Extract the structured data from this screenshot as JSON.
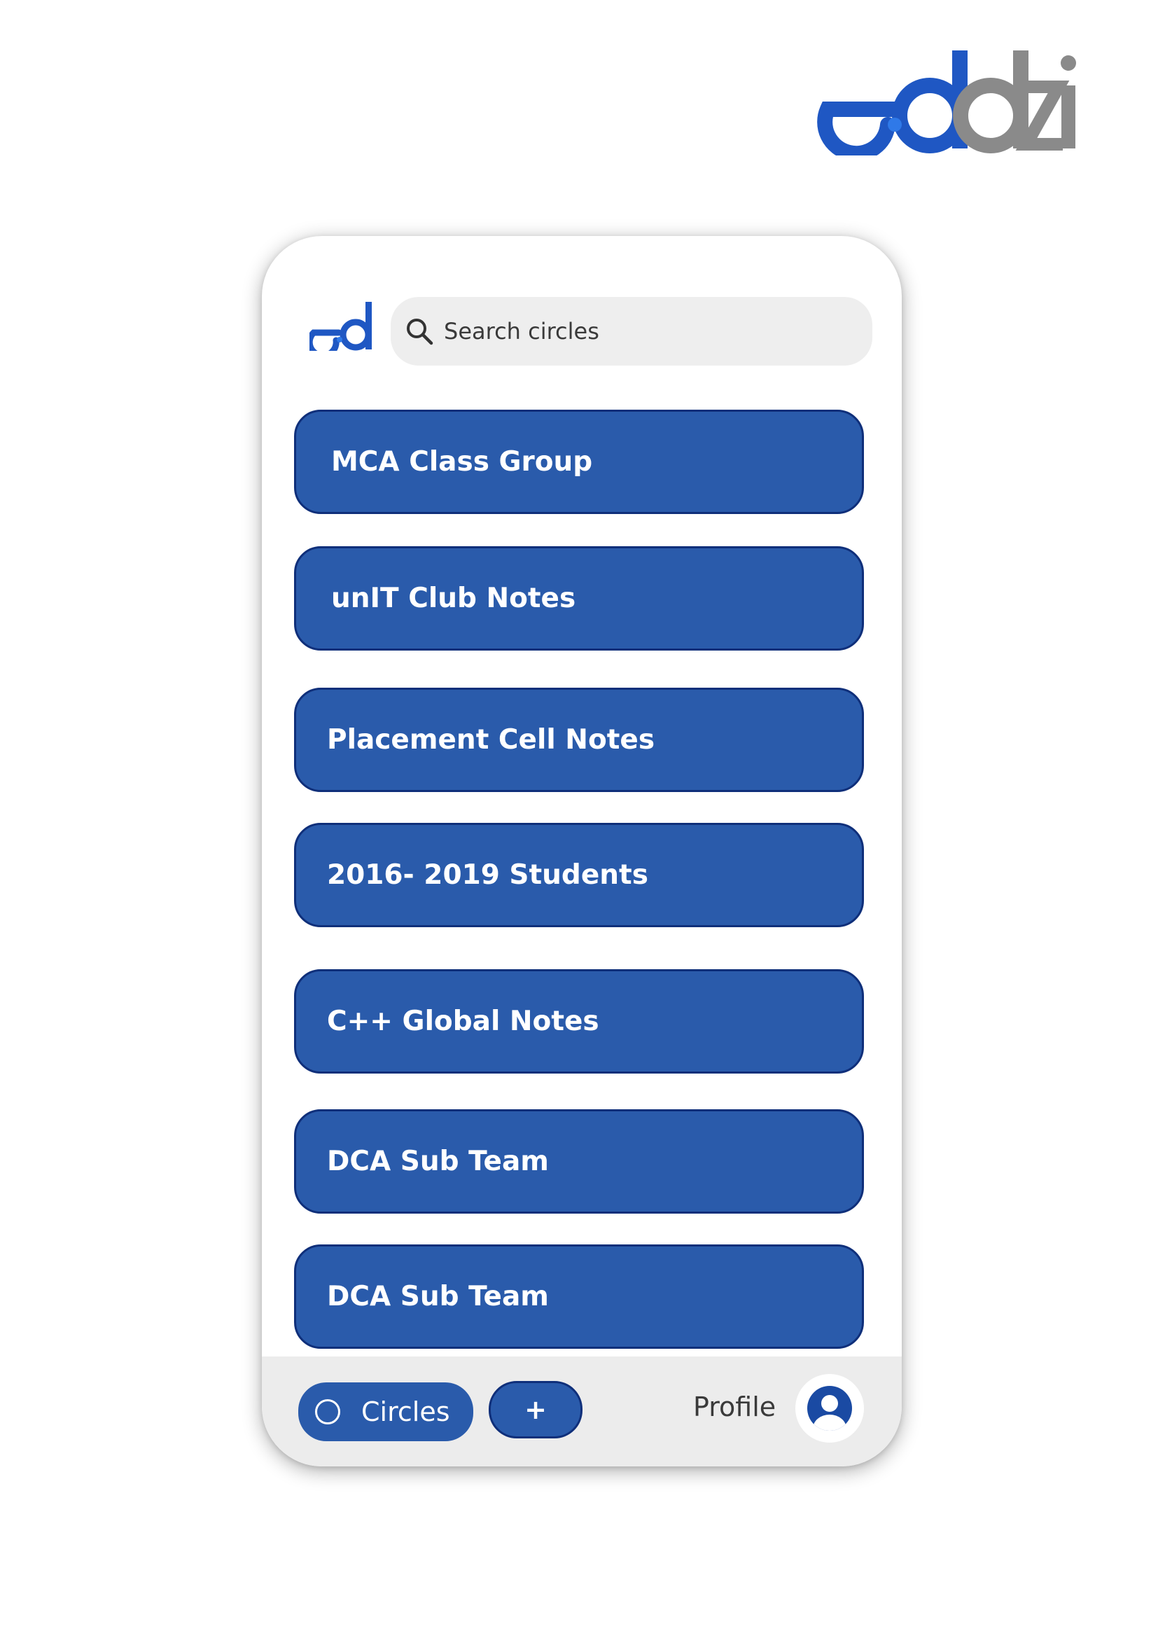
{
  "brand": {
    "logo_text": "eddzi",
    "primary_color": "#1f57c3",
    "secondary_color": "#8a8a8a"
  },
  "header": {
    "logo_text": "ed",
    "search": {
      "placeholder": "Search circles",
      "icon": "search-icon"
    }
  },
  "circles": [
    {
      "label": "MCA Class Group"
    },
    {
      "label": "unIT Club Notes"
    },
    {
      "label": "Placement Cell Notes"
    },
    {
      "label": "2016- 2019 Students"
    },
    {
      "label": "C++ Global Notes"
    },
    {
      "label": "DCA Sub Team"
    },
    {
      "label": "DCA Sub Team"
    }
  ],
  "bottom_nav": {
    "circles_label": "Circles",
    "circles_icon": "circle-ring-icon",
    "add_label": "+",
    "profile_label": "Profile",
    "avatar_icon": "user-avatar-icon"
  },
  "colors": {
    "item_fill": "#2a5bab",
    "item_border": "#0f2f7a",
    "nav_bg": "#ececec",
    "search_bg": "#eeeeee"
  }
}
